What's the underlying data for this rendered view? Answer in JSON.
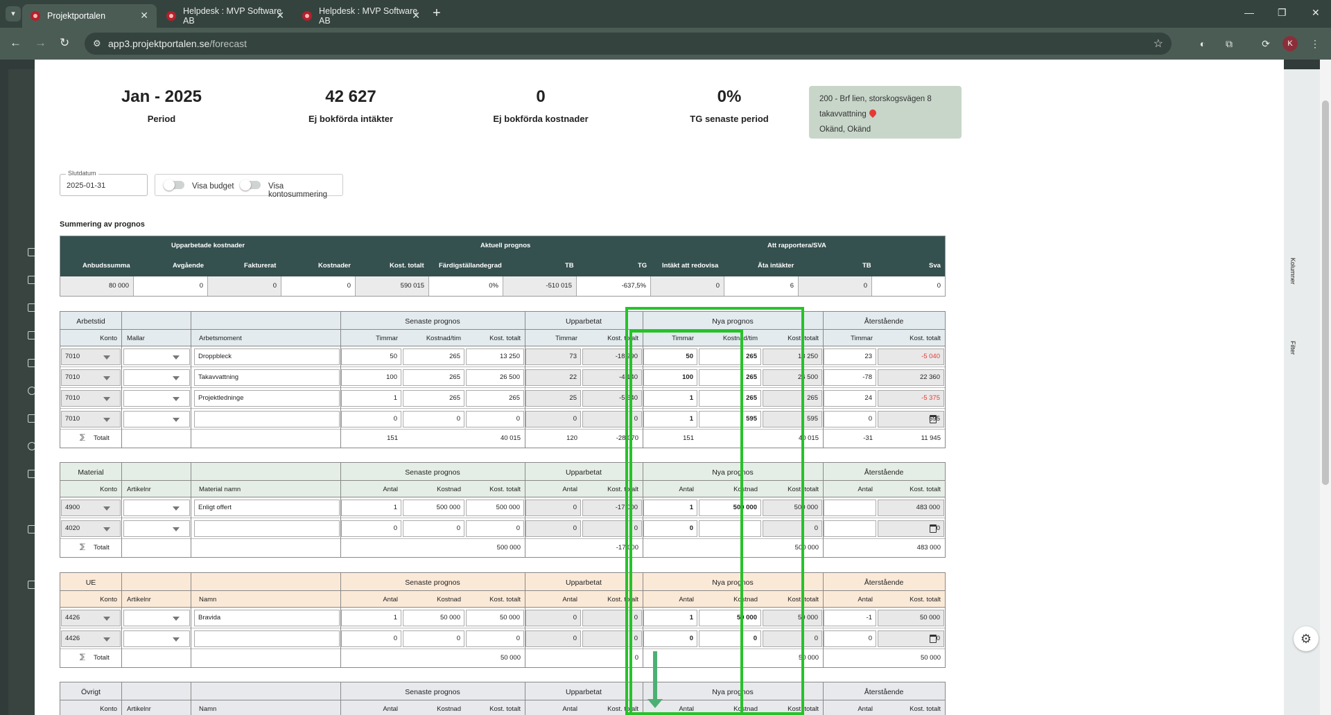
{
  "browser": {
    "tabs": [
      {
        "label": "Projektportalen",
        "active": true
      },
      {
        "label": "Helpdesk : MVP Software AB",
        "active": false
      },
      {
        "label": "Helpdesk : MVP Software AB",
        "active": false
      }
    ],
    "url_host": "app3.projektportalen.se",
    "url_path": "/forecast",
    "profile_initial": "K"
  },
  "kpis": [
    {
      "value": "Jan - 2025",
      "label": "Period"
    },
    {
      "value": "42 627",
      "label": "Ej bokförda intäkter"
    },
    {
      "value": "0",
      "label": "Ej bokförda kostnader"
    },
    {
      "value": "0%",
      "label": "TG senaste period"
    }
  ],
  "project": {
    "line1": "200 - Brf lien, storskogsvägen 8",
    "line2": "takavvattning",
    "line3": "Okänd, Okänd"
  },
  "controls": {
    "date_label": "Slutdatum",
    "date_value": "2025-01-31",
    "toggle1": "Visa budget",
    "toggle2": "Visa kontosummering"
  },
  "summary": {
    "title": "Summering av prognos",
    "groups": [
      "Upparbetade kostnader",
      "Aktuell prognos",
      "Att rapportera/SVA"
    ],
    "headers": [
      "Anbudssumma",
      "Avgående",
      "Fakturerat",
      "Kostnader",
      "Kost. totalt",
      "Färdigställandegrad",
      "TB",
      "TG",
      "Intäkt att redovisa",
      "Äta intäkter",
      "TB",
      "Sva"
    ],
    "values": [
      "80 000",
      "0",
      "0",
      "0",
      "590 015",
      "0%",
      "-510 015",
      "-637,5%",
      "0",
      "6",
      "0",
      "0"
    ]
  },
  "sections": {
    "labels": {
      "senaste": "Senaste prognos",
      "upparbetat": "Upparbetat",
      "nya": "Nya prognos",
      "aterstaende": "Återstående",
      "konto": "Konto",
      "totalt": "Totalt",
      "kost_totalt": "Kost. totalt"
    },
    "arbetstid": {
      "title": "Arbetstid",
      "cols": [
        "Mallar",
        "Arbetsmoment",
        "Timmar",
        "Kostnad/tim",
        "Timmar",
        "Timmar",
        "Kostnad/tim",
        "Timmar"
      ],
      "rows": [
        {
          "konto": "7010",
          "namn": "Droppbleck",
          "s_a": "50",
          "s_k": "265",
          "s_t": "13 250",
          "u_a": "73",
          "u_t": "-18 290",
          "n_a": "50",
          "n_k": "265",
          "n_t": "13 250",
          "a_a": "23",
          "a_t": "-5 040",
          "a_t_red": true
        },
        {
          "konto": "7010",
          "namn": "Takavvattning",
          "s_a": "100",
          "s_k": "265",
          "s_t": "26 500",
          "u_a": "22",
          "u_t": "-4 140",
          "n_a": "100",
          "n_k": "265",
          "n_t": "26 500",
          "a_a": "-78",
          "a_t": "22 360",
          "a_t_red": false
        },
        {
          "konto": "7010",
          "namn": "Projektledninge",
          "s_a": "1",
          "s_k": "265",
          "s_t": "265",
          "u_a": "25",
          "u_t": "-5 640",
          "n_a": "1",
          "n_k": "265",
          "n_t": "265",
          "a_a": "24",
          "a_t": "-5 375",
          "a_t_red": true
        },
        {
          "konto": "7010",
          "namn": "",
          "s_a": "0",
          "s_k": "0",
          "s_t": "0",
          "u_a": "0",
          "u_t": "0",
          "n_a": "1",
          "n_k": "595",
          "n_t": "595",
          "a_a": "0",
          "a_t": "595",
          "a_t_red": false
        }
      ],
      "total": {
        "s_a": "151",
        "s_t": "40 015",
        "u_a": "120",
        "u_t": "-28 070",
        "n_a": "151",
        "n_t": "40 015",
        "a_a": "-31",
        "a_t": "11 945"
      }
    },
    "material": {
      "title": "Material",
      "cols": [
        "Artikelnr",
        "Material namn",
        "Antal",
        "Kostnad",
        "Antal",
        "Antal",
        "Kostnad",
        "Antal"
      ],
      "rows": [
        {
          "konto": "4900",
          "namn": "Enligt offert",
          "s_a": "1",
          "s_k": "500 000",
          "s_t": "500 000",
          "u_a": "0",
          "u_t": "-17 000",
          "n_a": "1",
          "n_k": "500 000",
          "n_t": "500 000",
          "a_a": "",
          "a_t": "483 000",
          "a_t_red": false
        },
        {
          "konto": "4020",
          "namn": "",
          "s_a": "0",
          "s_k": "0",
          "s_t": "0",
          "u_a": "0",
          "u_t": "0",
          "n_a": "0",
          "n_k": "",
          "n_t": "0",
          "a_a": "",
          "a_t": "0",
          "a_t_red": false
        }
      ],
      "total": {
        "s_a": "",
        "s_t": "500 000",
        "u_a": "",
        "u_t": "-17 000",
        "n_a": "",
        "n_t": "500 000",
        "a_a": "",
        "a_t": "483 000"
      }
    },
    "ue": {
      "title": "UE",
      "cols": [
        "Artikelnr",
        "Namn",
        "Antal",
        "Kostnad",
        "Antal",
        "Antal",
        "Kostnad",
        "Antal"
      ],
      "rows": [
        {
          "konto": "4426",
          "namn": "Bravida",
          "s_a": "1",
          "s_k": "50 000",
          "s_t": "50 000",
          "u_a": "0",
          "u_t": "0",
          "n_a": "1",
          "n_k": "50 000",
          "n_t": "50 000",
          "a_a": "-1",
          "a_t": "50 000",
          "a_t_red": false
        },
        {
          "konto": "4426",
          "namn": "",
          "s_a": "0",
          "s_k": "0",
          "s_t": "0",
          "u_a": "0",
          "u_t": "0",
          "n_a": "0",
          "n_k": "0",
          "n_t": "0",
          "a_a": "0",
          "a_t": "0",
          "a_t_red": false
        }
      ],
      "total": {
        "s_a": "",
        "s_t": "50 000",
        "u_a": "",
        "u_t": "0",
        "n_a": "",
        "n_t": "50 000",
        "a_a": "",
        "a_t": "50 000"
      }
    },
    "ovrigt": {
      "title": "Övrigt",
      "cols": [
        "Artikelnr",
        "Namn",
        "Antal",
        "Kostnad",
        "Antal",
        "Antal",
        "Kostnad",
        "Antal"
      ],
      "rows": [],
      "total": null
    }
  },
  "right_panel": {
    "kolumner": "Kolumner",
    "filter": "Filter"
  },
  "colors": {
    "arbetstid_header": "#e3ebef",
    "material_header": "#e5eee6",
    "ue_header": "#fbe9d7",
    "ovrigt_header": "#e8e9ec",
    "highlight": "#27c22a",
    "summary_header": "#34504f"
  }
}
